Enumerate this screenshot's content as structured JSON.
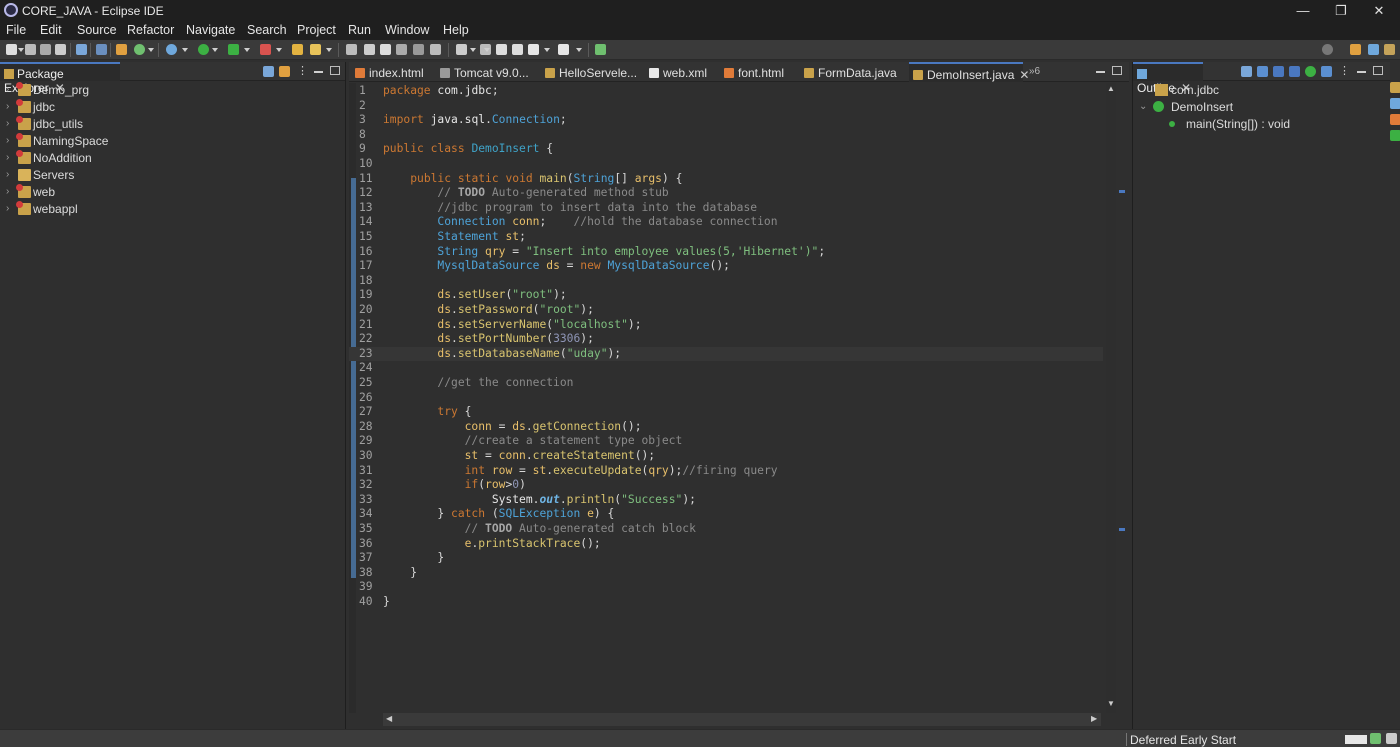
{
  "window": {
    "title": "CORE_JAVA - Eclipse IDE",
    "minimize": "—",
    "maximize": "❐",
    "close": "✕"
  },
  "menu": [
    "File",
    "Edit",
    "Source",
    "Refactor",
    "Navigate",
    "Search",
    "Project",
    "Run",
    "Window",
    "Help"
  ],
  "package_explorer": {
    "title": "Package Explorer",
    "projects": [
      "Demo_prg",
      "jdbc",
      "jdbc_utils",
      "NamingSpace",
      "NoAddition",
      "Servers",
      "web",
      "webappl"
    ]
  },
  "editor": {
    "tabs": [
      "index.html",
      "Tomcat v9.0...",
      "HelloServele...",
      "web.xml",
      "font.html",
      "FormData.java",
      "DemoInsert.java"
    ],
    "overflow": "»6",
    "active_tab": "DemoInsert.java",
    "lines": [
      {
        "n": "1",
        "t": "package com.jdbc;"
      },
      {
        "n": "2",
        "t": ""
      },
      {
        "n": "3",
        "t": "import java.sql.Connection;"
      },
      {
        "n": "8",
        "t": ""
      },
      {
        "n": "9",
        "t": "public class DemoInsert {"
      },
      {
        "n": "10",
        "t": ""
      },
      {
        "n": "11",
        "t": "    public static void main(String[] args) {"
      },
      {
        "n": "12",
        "t": "        // TODO Auto-generated method stub"
      },
      {
        "n": "13",
        "t": "        //jdbc program to insert data into the database"
      },
      {
        "n": "14",
        "t": "        Connection conn;    //hold the database connection"
      },
      {
        "n": "15",
        "t": "        Statement st;"
      },
      {
        "n": "16",
        "t": "        String qry = \"Insert into employee values(5,'Hibernet')\";"
      },
      {
        "n": "17",
        "t": "        MysqlDataSource ds = new MysqlDataSource();"
      },
      {
        "n": "18",
        "t": ""
      },
      {
        "n": "19",
        "t": "        ds.setUser(\"root\");"
      },
      {
        "n": "20",
        "t": "        ds.setPassword(\"root\");"
      },
      {
        "n": "21",
        "t": "        ds.setServerName(\"localhost\");"
      },
      {
        "n": "22",
        "t": "        ds.setPortNumber(3306);"
      },
      {
        "n": "23",
        "t": "        ds.setDatabaseName(\"uday\");"
      },
      {
        "n": "24",
        "t": ""
      },
      {
        "n": "25",
        "t": "        //get the connection"
      },
      {
        "n": "26",
        "t": ""
      },
      {
        "n": "27",
        "t": "        try {"
      },
      {
        "n": "28",
        "t": "            conn = ds.getConnection();"
      },
      {
        "n": "29",
        "t": "            //create a statement type object"
      },
      {
        "n": "30",
        "t": "            st = conn.createStatement();"
      },
      {
        "n": "31",
        "t": "            int row = st.executeUpdate(qry);//firing query"
      },
      {
        "n": "32",
        "t": "            if(row>0)"
      },
      {
        "n": "33",
        "t": "                System.out.println(\"Success\");"
      },
      {
        "n": "34",
        "t": "        } catch (SQLException e) {"
      },
      {
        "n": "35",
        "t": "            // TODO Auto-generated catch block"
      },
      {
        "n": "36",
        "t": "            e.printStackTrace();"
      },
      {
        "n": "37",
        "t": "        }"
      },
      {
        "n": "38",
        "t": "    }"
      },
      {
        "n": "39",
        "t": ""
      },
      {
        "n": "40",
        "t": "}"
      }
    ]
  },
  "outline": {
    "title": "Outline",
    "items": [
      "com.jdbc",
      "DemoInsert",
      "main(String[]) : void"
    ]
  },
  "status": {
    "text": "Deferred Early Start"
  },
  "colors": {
    "accent": "#4a78c0",
    "keyword": "#cc7832",
    "string": "#7fbf7f",
    "type": "#4ea3d8",
    "method": "#d9c46f",
    "comment": "#8a8a8a"
  }
}
